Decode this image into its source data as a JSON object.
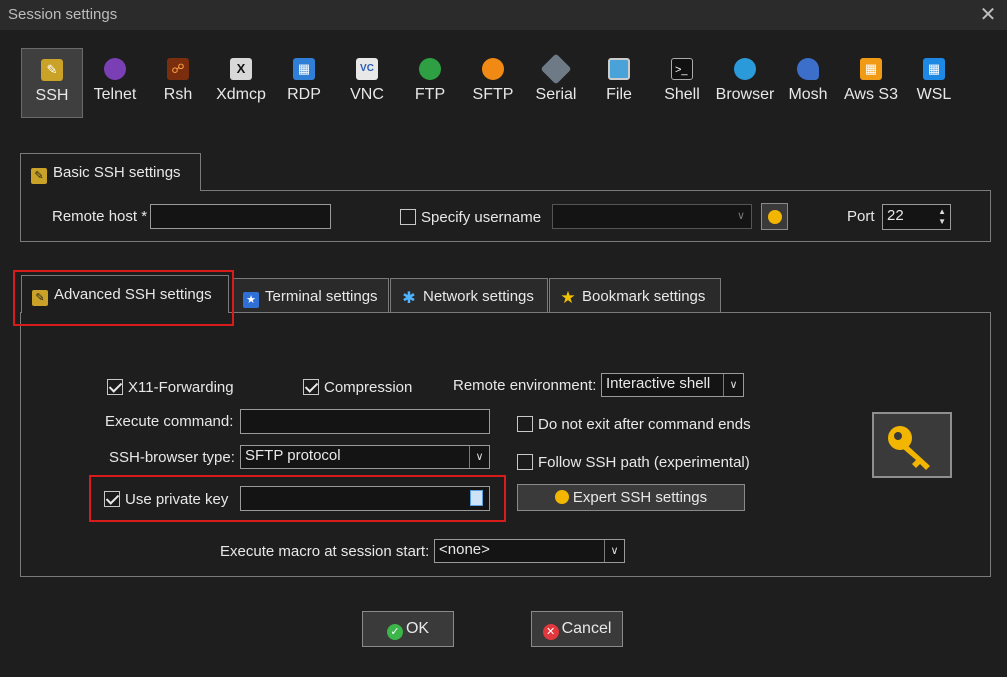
{
  "window": {
    "title": "Session settings",
    "close_symbol": "✕"
  },
  "session_types": [
    {
      "label": "SSH",
      "icon": "ssh-key-icon",
      "selected": true
    },
    {
      "label": "Telnet",
      "icon": "telnet-icon"
    },
    {
      "label": "Rsh",
      "icon": "rsh-icon"
    },
    {
      "label": "Xdmcp",
      "icon": "xdmcp-icon"
    },
    {
      "label": "RDP",
      "icon": "rdp-icon"
    },
    {
      "label": "VNC",
      "icon": "vnc-icon"
    },
    {
      "label": "FTP",
      "icon": "ftp-globe-icon"
    },
    {
      "label": "SFTP",
      "icon": "sftp-icon"
    },
    {
      "label": "Serial",
      "icon": "serial-plug-icon"
    },
    {
      "label": "File",
      "icon": "file-icon"
    },
    {
      "label": "Shell",
      "icon": "shell-terminal-icon"
    },
    {
      "label": "Browser",
      "icon": "browser-globe-icon"
    },
    {
      "label": "Mosh",
      "icon": "mosh-satellite-icon"
    },
    {
      "label": "Aws S3",
      "icon": "aws-s3-icon"
    },
    {
      "label": "WSL",
      "icon": "wsl-windows-icon"
    }
  ],
  "basic": {
    "tab_label": "Basic SSH settings",
    "remote_host_label": "Remote host *",
    "remote_host_value": "",
    "specify_username_label": "Specify username",
    "specify_username_checked": false,
    "username_value": "",
    "port_label": "Port",
    "port_value": "22"
  },
  "tabs": [
    {
      "label": "Advanced SSH settings",
      "active": true
    },
    {
      "label": "Terminal settings"
    },
    {
      "label": "Network settings"
    },
    {
      "label": "Bookmark settings"
    }
  ],
  "advanced": {
    "x11_label": "X11-Forwarding",
    "x11_checked": true,
    "compression_label": "Compression",
    "compression_checked": true,
    "remote_env_label": "Remote environment:",
    "remote_env_value": "Interactive shell",
    "execute_command_label": "Execute command:",
    "execute_command_value": "",
    "do_not_exit_label": "Do not exit after command ends",
    "do_not_exit_checked": false,
    "ssh_browser_label": "SSH-browser type:",
    "ssh_browser_value": "SFTP protocol",
    "follow_path_label": "Follow SSH path (experimental)",
    "follow_path_checked": false,
    "private_key_label": "Use private key",
    "private_key_checked": true,
    "private_key_value": "",
    "expert_button_label": "Expert SSH settings",
    "macro_label": "Execute macro at session start:",
    "macro_value": "<none>"
  },
  "footer": {
    "ok_label": "OK",
    "cancel_label": "Cancel"
  },
  "colors": {
    "highlight": "#d81b1b",
    "accent_key": "#f2b600"
  }
}
